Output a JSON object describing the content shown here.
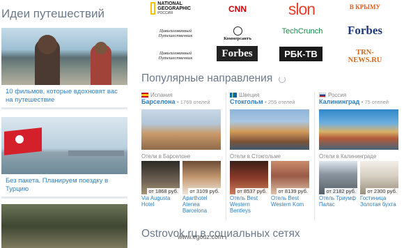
{
  "left": {
    "title": "Идеи путешествий",
    "cards": [
      {
        "caption": "10 фильмов, которые вдохновят вас на путешествие"
      },
      {
        "caption": "Без пакета. Планируем поездку в Турцию"
      }
    ]
  },
  "logos": [
    {
      "text": "NATIONAL GEOGRAPHIC",
      "sub": "РОССИЯ"
    },
    {
      "text": "CNN"
    },
    {
      "text": "slon"
    },
    {
      "text": "В КРЫМУ"
    },
    {
      "text": "Цивилизованный Путешественник"
    },
    {
      "text": "Коммерсантъ"
    },
    {
      "text": "TechCrunch"
    },
    {
      "text": "Forbes"
    },
    {
      "text": "Цивилизованный Путешественник"
    },
    {
      "text": "Forbes"
    },
    {
      "text": "РБК-ТВ"
    },
    {
      "text": "TRN-NEWS.RU"
    }
  ],
  "popular": {
    "title": "Популярные направления",
    "destinations": [
      {
        "country": "Испания",
        "city": "Барселона",
        "count": "• 1769 отелей",
        "hotels_label": "Отели в Барселоне",
        "hotels": [
          {
            "price": "от 1868 руб.",
            "name": "Via Augusta Hotel"
          },
          {
            "price": "от 3109 руб.",
            "name": "Aparthotel Atenea Barcelona"
          }
        ]
      },
      {
        "country": "Швеция",
        "city": "Стокгольм",
        "count": "• 255 отелей",
        "hotels_label": "Отели в Стокгольме",
        "hotels": [
          {
            "price": "от 8537 руб.",
            "name": "Отель Best Western Bentleys"
          },
          {
            "price": "от 8139 руб.",
            "name": "Отель Best Western Kom"
          }
        ]
      },
      {
        "country": "Россия",
        "city": "Калининград",
        "count": "• 75 отелей",
        "hotels_label": "Отели в Калининграде",
        "hotels": [
          {
            "price": "от 2182 руб.",
            "name": "Отель Триумф Палас"
          },
          {
            "price": "от 2300 руб.",
            "name": "Гостиница Золотая бухта"
          }
        ]
      }
    ]
  },
  "social": {
    "title": "Ostrovok.ru в социальных сетях"
  },
  "watermark": {
    "text": "www.egouz.com"
  },
  "colors": {
    "link": "#2f7fc1",
    "heading": "#6a7a8a"
  }
}
